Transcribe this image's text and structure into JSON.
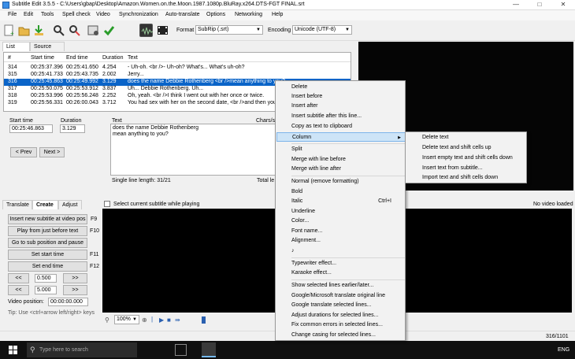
{
  "window": {
    "title": "Subtitle Edit 3.5.5 - C:\\Users\\gbap\\Desktop\\Amazon.Women.on.the.Moon.1987.1080p.BluRay.x264.DTS-FGT FINAL.srt",
    "min": "—",
    "max": "□",
    "close": "✕"
  },
  "menu": [
    "File",
    "Edit",
    "Tools",
    "Spell check",
    "Video",
    "Synchronization",
    "Auto-translate",
    "Options",
    "Networking",
    "Help"
  ],
  "toolbar": {
    "format_label": "Format",
    "format_value": "SubRip (.srt)",
    "encoding_label": "Encoding",
    "encoding_value": "Unicode (UTF-8)"
  },
  "tabs": {
    "list_view": "List view",
    "source_view": "Source view"
  },
  "grid": {
    "headers": [
      "#",
      "Start time",
      "End time",
      "Duration",
      "Text"
    ],
    "rows": [
      [
        "314",
        "00:25:37.396",
        "00:25:41.650",
        "4.254",
        "- Uh-oh. <br />- Uh-oh? What's... What's uh-oh?"
      ],
      [
        "315",
        "00:25:41.733",
        "00:25:43.735",
        "2.002",
        "Jerry..."
      ],
      [
        "316",
        "00:25:45.863",
        "00:25:49.992",
        "3.129",
        "does the name Debbie Rothenberg <br />mean anything to you?"
      ],
      [
        "317",
        "00:25:50.075",
        "00:25:53.912",
        "3.837",
        "Uh... Debbie Rothenberg. Uh..."
      ],
      [
        "318",
        "00:25:53.996",
        "00:25:56.248",
        "2.252",
        "Oh, yeah. <br />I think I went out with her once or twice."
      ],
      [
        "319",
        "00:25:56.331",
        "00:26:00.043",
        "3.712",
        "You had sex with her on the second date, <br />and then you never"
      ]
    ]
  },
  "edit": {
    "start_label": "Start time",
    "duration_label": "Duration",
    "text_label": "Text",
    "chars_label": "Chars/se",
    "start_value": "00:25:46.863",
    "duration_value": "3.129",
    "text_line1": "does the name Debbie Rothenberg",
    "text_line2": "mean anything to you?",
    "prev": "< Prev",
    "next": "Next >",
    "line_length": "Single line length: 31/21",
    "total_length": "Total le"
  },
  "bottom": {
    "tab_translate": "Translate",
    "tab_create": "Create",
    "tab_adjust": "Adjust",
    "select_current": "Select current subtitle while playing",
    "no_video": "No video loaded"
  },
  "create": {
    "insert_btn": "Insert new subtitle at video pos",
    "insert_key": "F9",
    "play_btn": "Play from just before text",
    "play_key": "F10",
    "goto_btn": "Go to sub position and pause",
    "set_start_btn": "Set start time",
    "set_start_key": "F11",
    "set_end_btn": "Set end time",
    "set_end_key": "F12",
    "small_back": "<<",
    "small_fwd": ">>",
    "step1": "0.500",
    "step2": "5.000",
    "video_pos_label": "Video position:",
    "video_pos_value": "00:00:00.000",
    "tip": "Tip: Use <ctrl+arrow left/right> keys"
  },
  "wave_controls": {
    "zoom": "100%"
  },
  "status": {
    "position": "316/1101"
  },
  "taskbar": {
    "search": "Type here to search",
    "lang": "ENG"
  },
  "context_menu": {
    "items": [
      "Delete",
      "Insert before",
      "Insert after",
      "Insert subtitle after this line...",
      "Copy as text to clipboard",
      "Column",
      "Split",
      "Merge with line before",
      "Merge with line after",
      "Normal (remove formatting)",
      "Bold",
      "Italic",
      "Underline",
      "Color...",
      "Font name...",
      "Alignment...",
      "♪",
      "Typewriter effect...",
      "Karaoke effect...",
      "Show selected lines earlier/later...",
      "Google/Microsoft translate original line",
      "Google translate selected lines...",
      "Adjust durations for selected lines...",
      "Fix common errors in selected lines...",
      "Change casing for selected lines..."
    ],
    "italic_shortcut": "Ctrl+I",
    "column_arrow": "▶"
  },
  "column_submenu": [
    "Delete text",
    "Delete text and shift cells up",
    "Insert empty text and shift cells down",
    "Insert text from subtitle...",
    "Import text and shift cells down"
  ]
}
